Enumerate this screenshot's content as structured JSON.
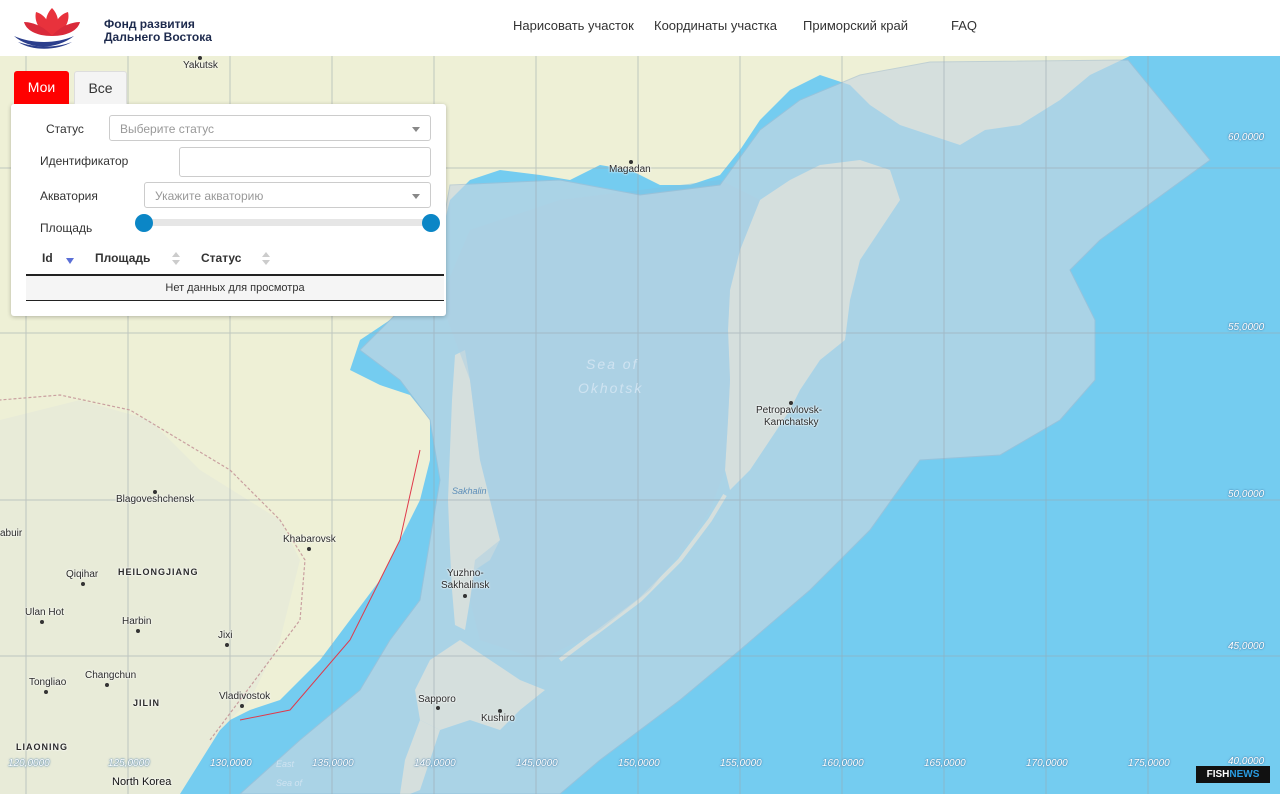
{
  "header": {
    "logo_line1": "Фонд развития",
    "logo_line2": "Дальнего Востока",
    "nav": [
      "Нарисовать участок",
      "Координаты участка",
      "Приморский край",
      "FAQ"
    ]
  },
  "tabs": {
    "mine": "Мои",
    "all": "Все"
  },
  "filter": {
    "status_label": "Статус",
    "status_placeholder": "Выберите статус",
    "id_label": "Идентификатор",
    "id_value": "",
    "water_label": "Акватория",
    "water_placeholder": "Укажите акваторию",
    "area_label": "Площадь"
  },
  "table": {
    "columns": [
      "Id",
      "Площадь",
      "Статус"
    ],
    "empty_text": "Нет данных для просмотра"
  },
  "map": {
    "places": {
      "yakutsk": "Yakutsk",
      "magadan": "Magadan",
      "petropavlovsk1": "Petropavlovsk-",
      "petropavlovsk2": "Kamchatsky",
      "sakhalin": "Sakhalin",
      "yuzhno1": "Yuzhno-",
      "yuzhno2": "Sakhalinsk",
      "blagoveshchensk": "Blagoveshchensk",
      "khabarovsk": "Khabarovsk",
      "qiqihar": "Qiqihar",
      "heilongjiang": "HEILONGJIANG",
      "ulan_hot": "Ulan Hot",
      "harbin": "Harbin",
      "jixi": "Jixi",
      "changchun": "Changchun",
      "jilin": "JILIN",
      "tongliao": "Tongliao",
      "vladivostok": "Vladivostok",
      "liaoning": "LIAONING",
      "north_korea": "North Korea",
      "sapporo": "Sapporo",
      "kushiro": "Kushiro",
      "harbin_cut": "abuir",
      "sea_of_okhotsk_1": "Sea of",
      "sea_of_okhotsk_2": "Okhotsk",
      "east_sea_1": "East",
      "east_sea_2": "Sea of"
    },
    "lat_labels": [
      "60,0000",
      "55,0000",
      "50,0000",
      "45,0000",
      "40,0000"
    ],
    "lon_labels": [
      "120,0000",
      "125,0000",
      "130,0000",
      "135,0000",
      "140,0000",
      "145,0000",
      "150,0000",
      "155,0000",
      "160,0000",
      "165,0000",
      "170,0000",
      "175,0000"
    ],
    "colors": {
      "water": "#74ccf0",
      "land": "#eef0d6",
      "zone": "#b9cfe0",
      "border": "#e0394b"
    }
  },
  "watermark": {
    "fish": "FISH",
    "news": "NEWS"
  }
}
